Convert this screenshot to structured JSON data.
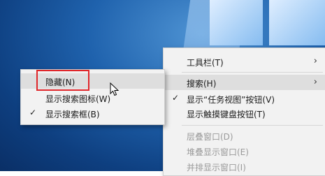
{
  "context_menu": {
    "items": [
      {
        "label": "工具栏(T)",
        "has_submenu": true
      },
      {
        "label": "搜索(H)",
        "has_submenu": true,
        "highlighted": true
      },
      {
        "label": "显示“任务视图”按钮(V)",
        "checked": true
      },
      {
        "label": "显示触摸键盘按钮(T)"
      },
      {
        "label": "层叠窗口(D)",
        "disabled": true
      },
      {
        "label": "堆叠显示窗口(E)",
        "disabled": true
      },
      {
        "label": "并排显示窗口(I)",
        "disabled": true
      }
    ]
  },
  "search_submenu": {
    "items": [
      {
        "label": "隐藏(N)",
        "highlighted": true
      },
      {
        "label": "显示搜索图标(W)"
      },
      {
        "label": "显示搜索框(B)",
        "checked": true
      }
    ]
  },
  "symbols": {
    "check": "✓",
    "arrow": "›"
  },
  "annotation": {
    "color": "#e0262a"
  }
}
